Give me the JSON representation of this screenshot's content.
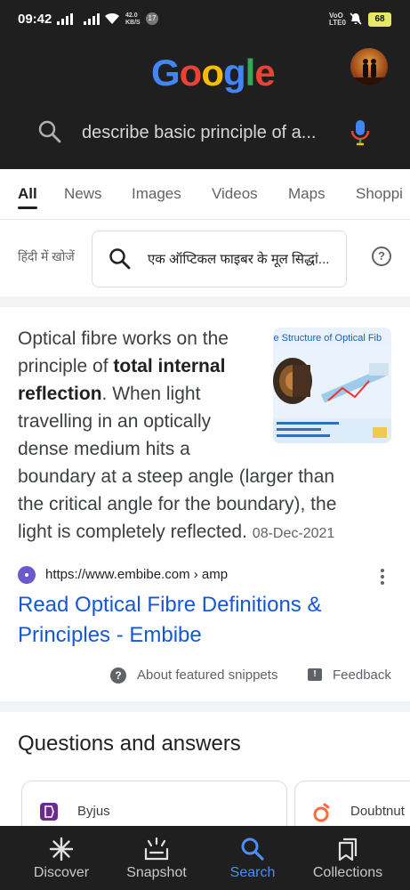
{
  "status_bar": {
    "time": "09:42",
    "speed_value": "42.0",
    "speed_unit": "KB/S",
    "notification_count": "17",
    "network_label_top": "VoO",
    "network_label_bottom": "LTE0",
    "battery": "68"
  },
  "header": {
    "logo_letters": [
      {
        "char": "G",
        "color": "#4285f4"
      },
      {
        "char": "o",
        "color": "#ea4335"
      },
      {
        "char": "o",
        "color": "#fbbc05"
      },
      {
        "char": "g",
        "color": "#4285f4"
      },
      {
        "char": "l",
        "color": "#34a853"
      },
      {
        "char": "e",
        "color": "#ea4335"
      }
    ],
    "search_query": "describe basic principle of a...",
    "avatar_icon": "avatar-icon"
  },
  "tabs": [
    "All",
    "News",
    "Images",
    "Videos",
    "Maps",
    "Shoppi"
  ],
  "hindi_search": {
    "label": "हिंदी में खोजें",
    "query": "एक ऑप्टिकल फाइबर के मूल सिद्धां..."
  },
  "featured_snippet": {
    "lines": [
      {
        "parts": [
          {
            "t": "Optical fibre works on the",
            "b": false
          }
        ]
      },
      {
        "parts": [
          {
            "t": "principle of ",
            "b": false
          },
          {
            "t": "total internal",
            "b": true
          }
        ]
      },
      {
        "parts": [
          {
            "t": "reflection",
            "b": true
          },
          {
            "t": ". When light",
            "b": false
          }
        ]
      },
      {
        "parts": [
          {
            "t": "travelling in an optically",
            "b": false
          }
        ]
      },
      {
        "parts": [
          {
            "t": "dense medium hits a",
            "b": false
          }
        ]
      },
      {
        "parts": [
          {
            "t": "boundary at a steep angle (larger than",
            "b": false
          }
        ]
      },
      {
        "parts": [
          {
            "t": "the critical angle for the boundary), the",
            "b": false
          }
        ]
      },
      {
        "parts": [
          {
            "t": "light is completely reflected.",
            "b": false
          }
        ]
      }
    ],
    "date": "08-Dec-2021",
    "thumbnail_title": "le Structure of Optical Fib",
    "source_url": "https://www.embibe.com › amp",
    "link_title": "Read Optical Fibre Definitions & Principles - Embibe",
    "about_label": "About featured snippets",
    "feedback_label": "Feedback"
  },
  "questions_answers": {
    "title": "Questions and answers",
    "cards": [
      {
        "label": "Byjus",
        "color": "#6a2c91"
      },
      {
        "label": "Doubtnut",
        "color": "#ff6a3d"
      }
    ]
  },
  "bottom_nav": [
    {
      "label": "Discover",
      "icon": "asterisk-icon",
      "active": false
    },
    {
      "label": "Snapshot",
      "icon": "snapshot-icon",
      "active": false
    },
    {
      "label": "Search",
      "icon": "search-icon",
      "active": true
    },
    {
      "label": "Collections",
      "icon": "collections-icon",
      "active": false
    }
  ],
  "colors": {
    "active_blue": "#4d8df6",
    "link_blue": "#1558d6",
    "dark_bg": "#1f1f1f"
  }
}
